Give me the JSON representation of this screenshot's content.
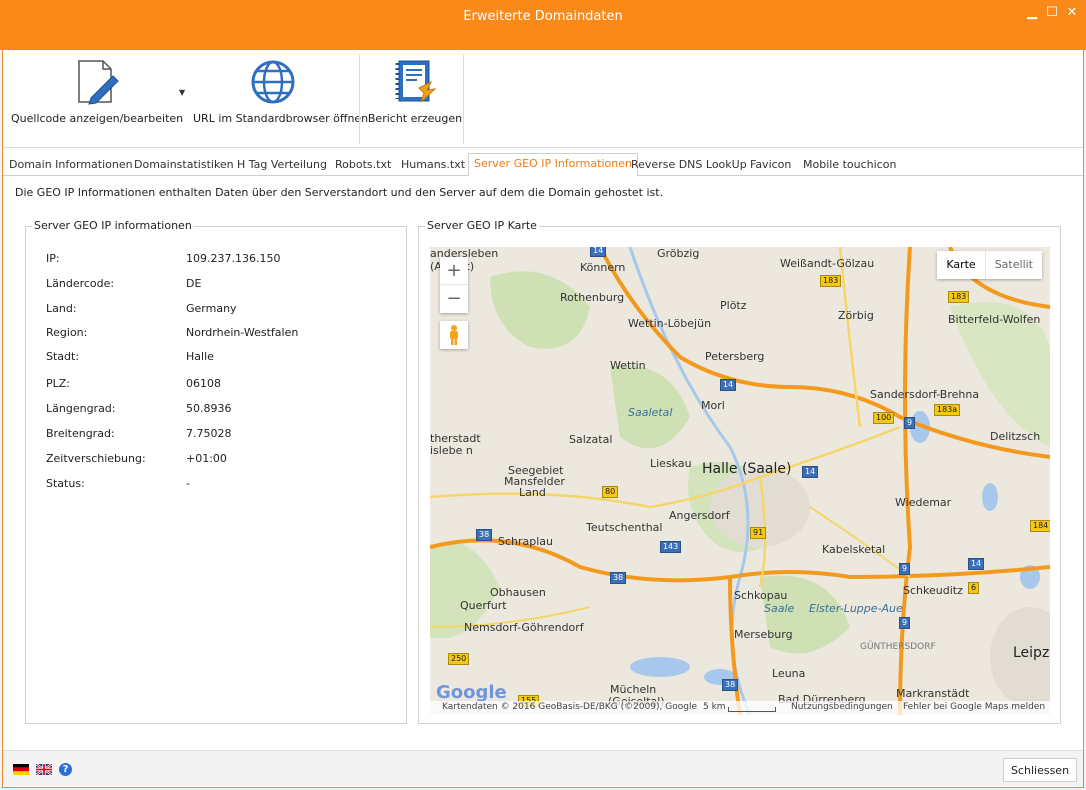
{
  "window": {
    "title": "Erweiterte Domaindaten"
  },
  "toolbar": {
    "source_label": "Quellcode anzeigen/bearbeiten",
    "url_label": "URL im Standardbrowser öffnen",
    "report_label": "Bericht erzeugen"
  },
  "tabs": [
    {
      "label": "Domain Informationen"
    },
    {
      "label": "Domainstatistiken"
    },
    {
      "label": "H Tag Verteilung"
    },
    {
      "label": "Robots.txt"
    },
    {
      "label": "Humans.txt"
    },
    {
      "label": "Server GEO IP Informationen",
      "active": true
    },
    {
      "label": "Reverse DNS LookUp"
    },
    {
      "label": "Favicon"
    },
    {
      "label": "Mobile touchicon"
    }
  ],
  "description": "Die GEO IP Informationen enthalten Daten über den Serverstandort und den Server auf dem die Domain gehostet ist.",
  "info": {
    "title": "Server GEO IP informationen",
    "rows": [
      {
        "label": "IP:",
        "value": "109.237.136.150"
      },
      {
        "label": "Ländercode:",
        "value": "DE"
      },
      {
        "label": "Land:",
        "value": "Germany"
      },
      {
        "label": "Region:",
        "value": "Nordrhein-Westfalen"
      },
      {
        "label": "Stadt:",
        "value": "Halle"
      },
      {
        "label": "PLZ:",
        "value": "06108"
      },
      {
        "label": "Längengrad:",
        "value": "50.8936"
      },
      {
        "label": "Breitengrad:",
        "value": "7.75028"
      },
      {
        "label": "Zeitverschiebung:",
        "value": "+01:00"
      },
      {
        "label": "Status:",
        "value": "-"
      }
    ]
  },
  "map": {
    "title": "Server GEO IP Karte",
    "type_map": "Karte",
    "type_sat": "Satellit",
    "zoom_in": "+",
    "zoom_out": "−",
    "attribution": "Kartendaten © 2016 GeoBasis-DE/BKG (©2009), Google",
    "scale": "5 km",
    "terms": "Nutzungsbedingungen",
    "report": "Fehler bei Google Maps melden",
    "logo": "Google",
    "places": {
      "halle": "Halle (Saale)",
      "koennern": "Könnern",
      "groebzig": "Gröbzig",
      "weissandt": "Weißandt-Gölzau",
      "rothenburg": "Rothenburg",
      "ploetz": "Plötz",
      "zoerbig": "Zörbig",
      "bitterfeld": "Bitterfeld-Wolfen",
      "wettin_loebejuen": "Wettin-Löbejün",
      "wettin": "Wettin",
      "petersberg": "Petersberg",
      "sandersdorf": "Sandersdorf-Brehna",
      "saaletal": "Saaletal",
      "morl": "Morl",
      "salzatal": "Salzatal",
      "delitzsch": "Delitzsch",
      "lieskau": "Lieskau",
      "seegebiet": "Seegebiet",
      "mansfelder": "Mansfelder",
      "land": "Land",
      "wiedemar": "Wiedemar",
      "angersdorf": "Angersdorf",
      "teutschenthal": "Teutschenthal",
      "schraplau": "Schraplau",
      "kabelsketal": "Kabelsketal",
      "obhausen": "Obhausen",
      "schkopau": "Schkopau",
      "schkeuditz": "Schkeuditz",
      "querfurt": "Querfurt",
      "saale": "Saale",
      "elster": "Elster-Luppe-Aue",
      "nemsdorf": "Nemsdorf-Göhrendorf",
      "merseburg": "Merseburg",
      "guenthersdorf": "GÜNTHERSDORF",
      "leipzig": "Leipz",
      "leuna": "Leuna",
      "muecheln": "Mücheln",
      "geiseltal": "(Geiseltal)",
      "duerrenberg": "Bad Dürrenberg",
      "markranstaedt": "Markranstädt",
      "sandersleben": "andersleben",
      "anhalt": "(Anhalt)",
      "eisleben": "islebe n",
      "stadt": "therstadt"
    },
    "shields": [
      "14",
      "183",
      "183",
      "14",
      "100",
      "183a",
      "9",
      "14",
      "80",
      "91",
      "38",
      "143",
      "38",
      "9",
      "6",
      "14",
      "184",
      "9",
      "250",
      "38",
      "155"
    ]
  },
  "footer": {
    "close_label": "Schliessen"
  }
}
